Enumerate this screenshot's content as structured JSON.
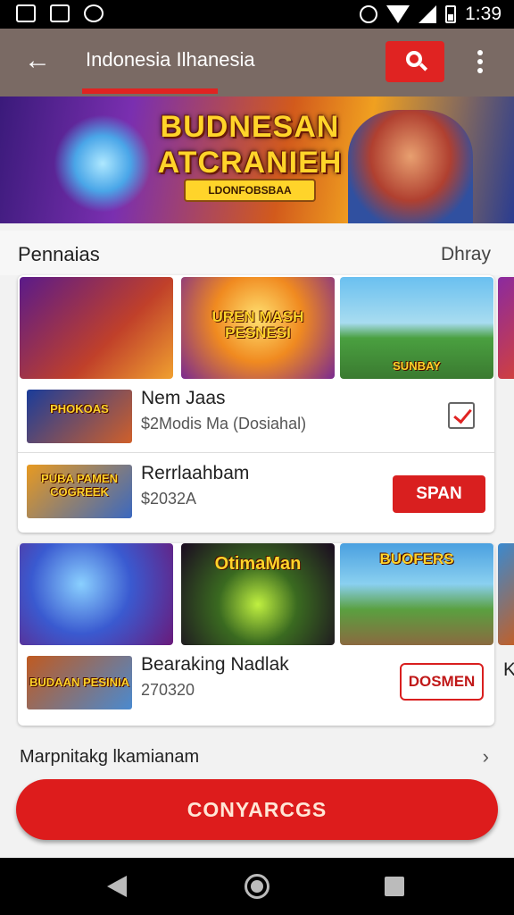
{
  "status_bar": {
    "time": "1:39"
  },
  "app_bar": {
    "title": "Indonesia Ilhanesia",
    "back_icon": "arrow-left-icon",
    "search_icon": "search-icon",
    "more_icon": "more-vertical-icon"
  },
  "banner": {
    "title": "BUDNESAN ATCRANIEH",
    "subtitle": "LDONFOBSBAA"
  },
  "section": {
    "title": "Pennaias",
    "more_label": "Dhray"
  },
  "thumb_row_1": [
    {
      "label": ""
    },
    {
      "label": "UREN MASH PESNESI"
    },
    {
      "label": "SUNBAY"
    }
  ],
  "items": [
    {
      "name": "Nem Jaas",
      "price": "$2Modis Ma (Dosiahal)",
      "thumb_label": "PHOKOAS",
      "control": "checkbox"
    },
    {
      "name": "Rerrlaahbam",
      "price": "$2032A",
      "thumb_label": "PUBA PAMEN COGREEK",
      "button_label": "SPAN"
    }
  ],
  "thumb_row_2": [
    {
      "label": ""
    },
    {
      "label": "OtimaMan"
    },
    {
      "label": "BUOFERS"
    }
  ],
  "item_3": {
    "name": "Bearaking Nadlak",
    "price": "270320",
    "thumb_label": "BUDAAN PESINIA",
    "button_label": "DOSMEN",
    "peek_letter": "K"
  },
  "footer_link": {
    "label": "Marpnitakg lkamianam"
  },
  "primary_button": {
    "label": "CONYARCGS"
  },
  "colors": {
    "accent": "#dd1c1c",
    "appbar": "#7a6a64"
  }
}
